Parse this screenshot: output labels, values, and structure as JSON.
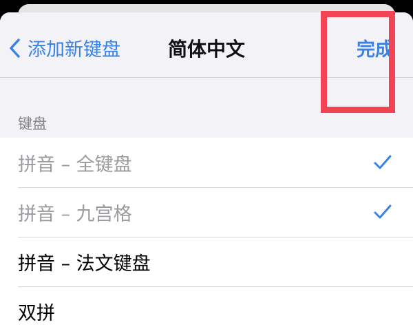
{
  "nav": {
    "back_label": "添加新键盘",
    "title": "简体中文",
    "done_label": "完成"
  },
  "section": {
    "header": "键盘"
  },
  "keyboards": [
    {
      "label": "拼音 – 全键盘",
      "added": true
    },
    {
      "label": "拼音 – 九宫格",
      "added": true
    },
    {
      "label": "拼音 – 法文键盘",
      "added": false
    },
    {
      "label": "双拼",
      "added": false
    }
  ],
  "colors": {
    "accent": "#3a82e4",
    "highlight_box": "#f24454",
    "disabled_text": "#9b9b9f"
  },
  "icons": {
    "back": "chevron-left-icon",
    "selected": "checkmark-icon"
  }
}
